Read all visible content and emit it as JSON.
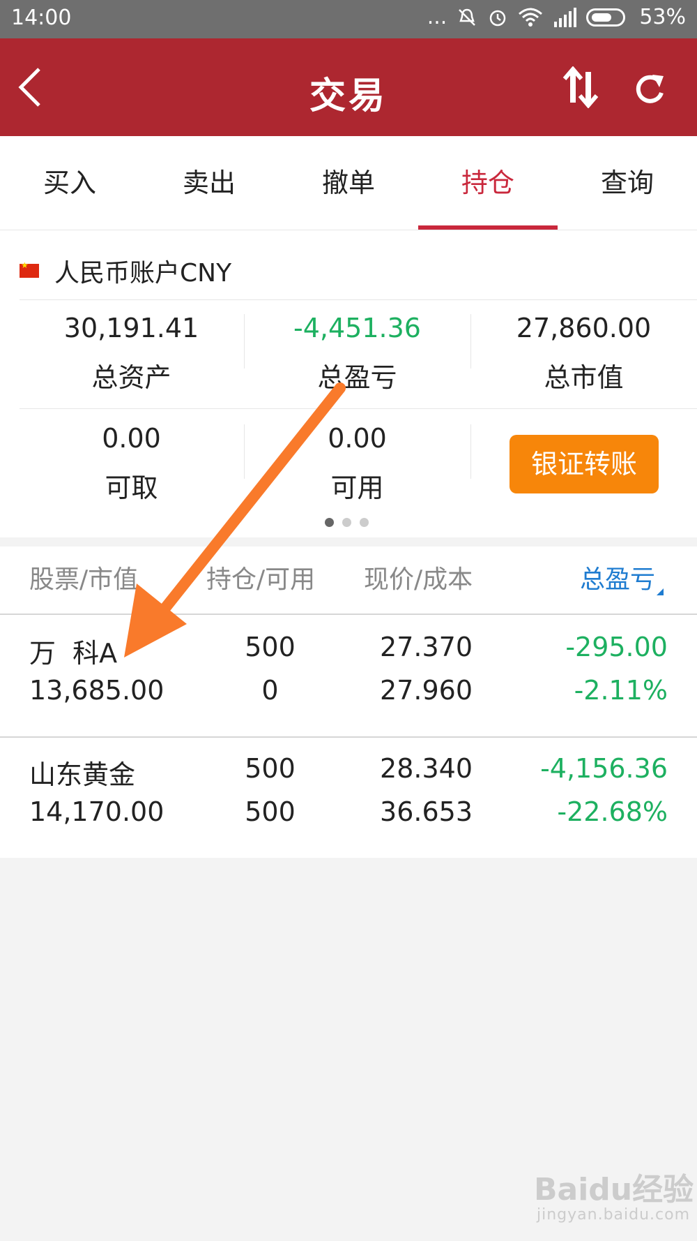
{
  "status_bar": {
    "time": "14:00",
    "dots": "...",
    "battery_percent": "53%"
  },
  "header": {
    "title": "交易"
  },
  "tabs": [
    {
      "label": "买入"
    },
    {
      "label": "卖出"
    },
    {
      "label": "撤单"
    },
    {
      "label": "持仓",
      "active": true
    },
    {
      "label": "查询"
    }
  ],
  "account": {
    "title": "人民币账户CNY",
    "total_assets": {
      "value": "30,191.41",
      "label": "总资产"
    },
    "total_pnl": {
      "value": "-4,451.36",
      "label": "总盈亏"
    },
    "market_value": {
      "value": "27,860.00",
      "label": "总市值"
    },
    "withdrawable": {
      "value": "0.00",
      "label": "可取"
    },
    "available": {
      "value": "0.00",
      "label": "可用"
    },
    "transfer_label": "银证转账"
  },
  "holdings": {
    "columns": [
      "股票/市值",
      "持仓/可用",
      "现价/成本",
      "总盈亏"
    ],
    "rows": [
      {
        "name": "万  科A",
        "market_value": "13,685.00",
        "position": "500",
        "available": "0",
        "price": "27.370",
        "cost": "27.960",
        "pnl": "-295.00",
        "pnl_pct": "-2.11%"
      },
      {
        "name": "山东黄金",
        "market_value": "14,170.00",
        "position": "500",
        "available": "500",
        "price": "28.340",
        "cost": "36.653",
        "pnl": "-4,156.36",
        "pnl_pct": "-22.68%"
      }
    ]
  },
  "watermark": {
    "brand": "Baidu经验",
    "url": "jingyan.baidu.com"
  },
  "colors": {
    "header_bg": "#ad2730",
    "accent_red": "#c9283c",
    "loss_green": "#1db060",
    "transfer_orange": "#f7860a",
    "sort_blue": "#1f7cd0",
    "annotation_arrow": "#f97a2b"
  }
}
